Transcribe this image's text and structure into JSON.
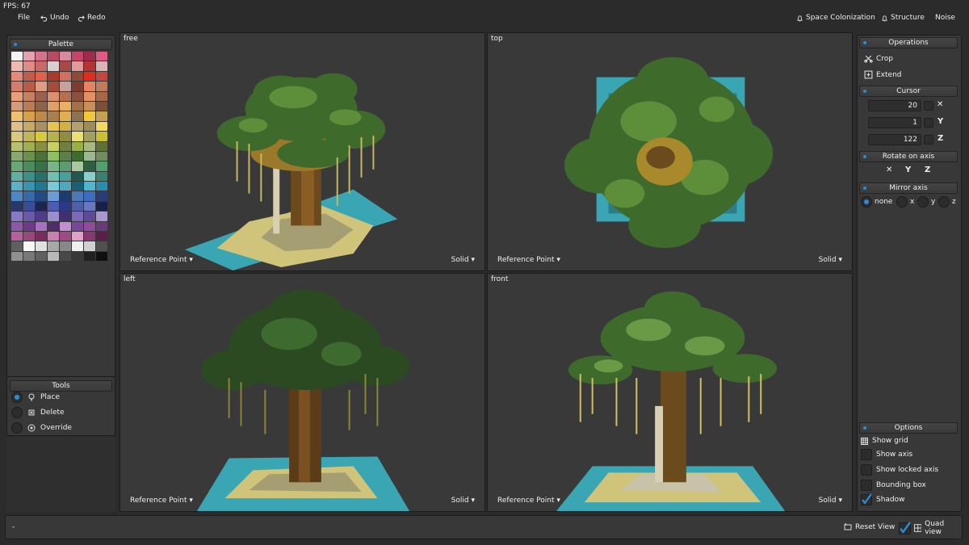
{
  "fps": "FPS: 67",
  "menu": {
    "file": "File",
    "undo": "Undo",
    "redo": "Redo"
  },
  "generators": {
    "space_colonization": "Space Colonization",
    "structure": "Structure",
    "noise": "Noise"
  },
  "palette": {
    "title": "Palette",
    "colors": [
      "#f4f4f4",
      "#e7a2b0",
      "#d6738a",
      "#b94a63",
      "#d98a9c",
      "#c4476b",
      "#9c2b4c",
      "#e05a84",
      "#f0b8b0",
      "#e08c86",
      "#c86a6a",
      "#d6d0d0",
      "#a84848",
      "#e09a98",
      "#b43434",
      "#d8b4b4",
      "#e88878",
      "#c05c4c",
      "#e06048",
      "#a83c2c",
      "#d07060",
      "#904838",
      "#e02c1c",
      "#c04840",
      "#d67c6c",
      "#b85c48",
      "#e09c80",
      "#a44c3c",
      "#c8a09c",
      "#7c3c30",
      "#e48460",
      "#c07a5c",
      "#e8a078",
      "#c48264",
      "#9c6050",
      "#d89070",
      "#b47050",
      "#8c5040",
      "#e49060",
      "#a86848",
      "#d49c7c",
      "#b87c58",
      "#8c6448",
      "#dca068",
      "#e8b060",
      "#a47048",
      "#c89058",
      "#7c5038",
      "#f0c070",
      "#d8a048",
      "#c08848",
      "#a88050",
      "#e0b050",
      "#8c7450",
      "#f0c838",
      "#c4a050",
      "#e0c088",
      "#c8a868",
      "#a89060",
      "#e8c44c",
      "#d4b040",
      "#b4a070",
      "#9c8c58",
      "#f4d860",
      "#d8c880",
      "#c4b458",
      "#d8c840",
      "#b8b04c",
      "#908c40",
      "#e8e070",
      "#a0a060",
      "#c8c030",
      "#b8c070",
      "#a0b050",
      "#889040",
      "#c8d060",
      "#708040",
      "#98b048",
      "#a8b880",
      "#607038",
      "#88a870",
      "#6c9050",
      "#4c7038",
      "#8cc060",
      "#5c8048",
      "#3c6c30",
      "#9cb890",
      "#708c60",
      "#68a878",
      "#4c8c5c",
      "#387048",
      "#78b488",
      "#5c9c70",
      "#a8c8a0",
      "#2c6040",
      "#50a070",
      "#60b0a0",
      "#3c9088",
      "#287068",
      "#70c0b0",
      "#48a098",
      "#205850",
      "#88d0c8",
      "#3c8070",
      "#5cb0c8",
      "#3894b0",
      "#207890",
      "#78c8d8",
      "#50a8c0",
      "#186078",
      "#4cb8d0",
      "#2c8cb0",
      "#4c88c8",
      "#3868a8",
      "#204c88",
      "#6c9cd8",
      "#1c3c70",
      "#4c78b8",
      "#3c6cc0",
      "#283c78",
      "#283868",
      "#384c98",
      "#1c2450",
      "#4c5cb0",
      "#2c3888",
      "#5060a8",
      "#6878c0",
      "#182048",
      "#8878c8",
      "#6c58a8",
      "#503c88",
      "#9c8cd0",
      "#403070",
      "#7c68b8",
      "#5c4c98",
      "#a898d0",
      "#8c58a8",
      "#6c3c88",
      "#a870c0",
      "#502c68",
      "#c090d0",
      "#784898",
      "#904c98",
      "#683c78",
      "#b8609c",
      "#98487c",
      "#782c60",
      "#c880b0",
      "#a04888",
      "#e0a0c8",
      "#883870",
      "#582048",
      "#606060",
      "#f8f8f8",
      "#e0e0e0",
      "#a8a8a8",
      "#888888",
      "#f0f0f0",
      "#d0d0d0",
      "#505050",
      "#909090",
      "#787878",
      "#606060",
      "#b8b8b8",
      "#484848",
      "#383838",
      "#202020",
      "#101010"
    ]
  },
  "tools": {
    "title": "Tools",
    "place": "Place",
    "delete": "Delete",
    "override": "Override"
  },
  "viewports": {
    "free": "free",
    "top": "top",
    "left": "left",
    "front": "front",
    "reference_point": "Reference Point",
    "solid": "Solid"
  },
  "operations": {
    "title": "Operations",
    "crop": "Crop",
    "extend": "Extend"
  },
  "cursor": {
    "title": "Cursor",
    "x": "20",
    "y": "1",
    "z": "122"
  },
  "rotate": {
    "title": "Rotate on axis"
  },
  "mirror": {
    "title": "Mirror axis",
    "none": "none",
    "x": "x",
    "y": "y",
    "z": "z"
  },
  "options": {
    "title": "Options",
    "show_grid": "Show grid",
    "show_axis": "Show axis",
    "show_locked_axis": "Show locked axis",
    "bounding_box": "Bounding box",
    "shadow": "Shadow"
  },
  "status": {
    "text": "-",
    "reset_view": "Reset View",
    "quad_view": "Quad view"
  },
  "colors": {
    "accent": "#2a8ed8",
    "panel": "#383838",
    "background": "#2b2b2b"
  }
}
